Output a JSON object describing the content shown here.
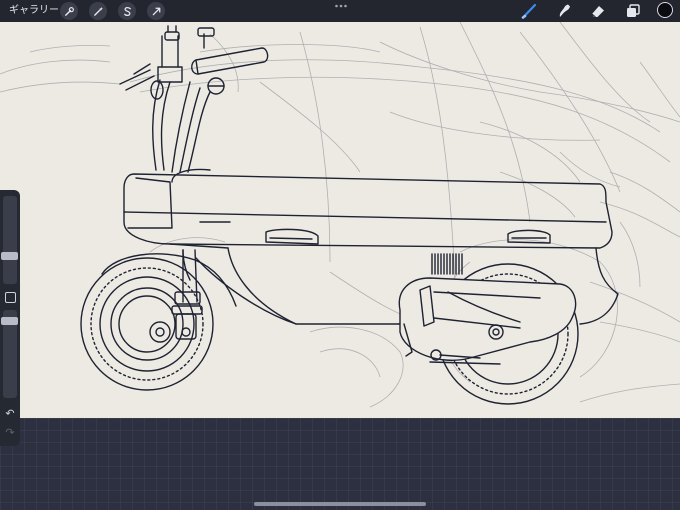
{
  "topbar": {
    "gallery_label": "ギャラリー",
    "left_tools": [
      "wrench-icon",
      "magic-wand-icon",
      "selection-s-icon",
      "transform-arrow-icon"
    ],
    "right_tools": [
      "brush-icon",
      "smudge-icon",
      "eraser-icon",
      "layers-icon"
    ],
    "active_tool": "brush-icon",
    "accent_color": "#3d8bf0",
    "current_color": "#0b0b12"
  },
  "sidebar": {
    "undo_glyph": "↶",
    "redo_glyph": "↷"
  },
  "canvas": {
    "background_color": "#eceae2",
    "line_color": "#1f2233",
    "sketch_color": "#9a9ca4"
  }
}
